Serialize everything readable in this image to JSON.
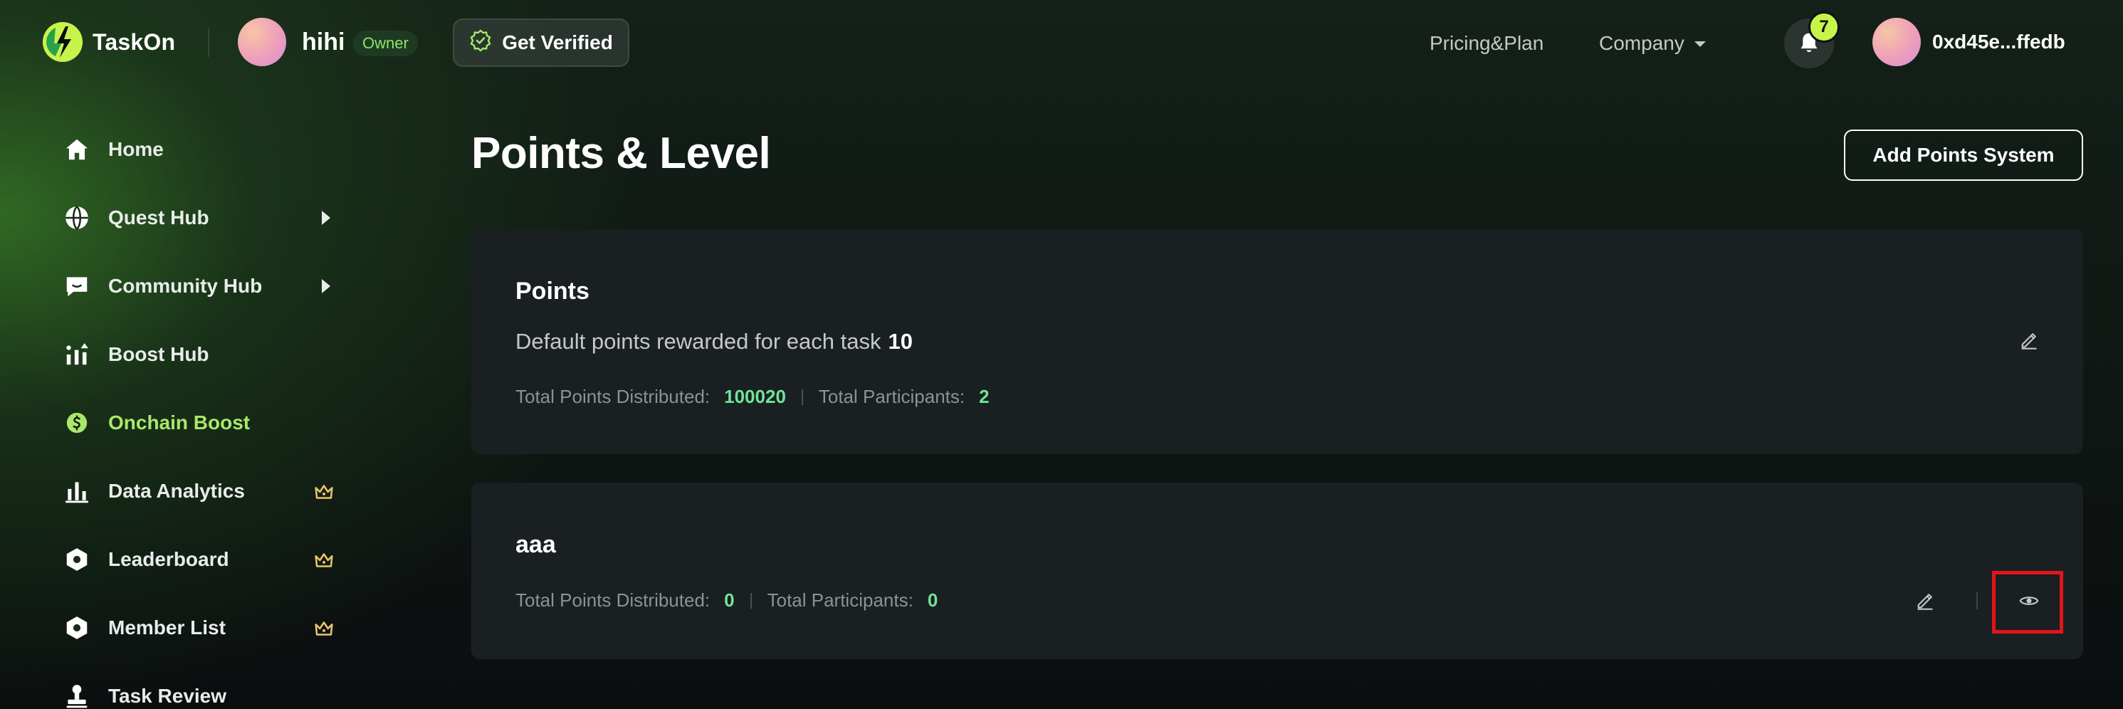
{
  "header": {
    "logo_text": "TaskOn",
    "project_name": "hihi",
    "owner_badge": "Owner",
    "verify_label": "Get Verified",
    "nav": {
      "pricing": "Pricing&Plan",
      "company": "Company"
    },
    "notification_count": "7",
    "user_address": "0xd45e...ffedb"
  },
  "sidebar": {
    "items": [
      {
        "label": "Home",
        "icon": "home-icon"
      },
      {
        "label": "Quest Hub",
        "icon": "globe-icon",
        "has_submenu": true
      },
      {
        "label": "Community Hub",
        "icon": "chat-icon",
        "has_submenu": true
      },
      {
        "label": "Boost Hub",
        "icon": "boost-icon"
      },
      {
        "label": "Onchain Boost",
        "icon": "coin-icon",
        "active": true
      },
      {
        "label": "Data Analytics",
        "icon": "bar-chart-icon",
        "premium": true
      },
      {
        "label": "Leaderboard",
        "icon": "hexagon-icon",
        "premium": true
      },
      {
        "label": "Member List",
        "icon": "hexagon-icon",
        "premium": true
      },
      {
        "label": "Task Review",
        "icon": "stamp-icon"
      }
    ]
  },
  "main": {
    "title": "Points & Level",
    "add_button": "Add Points System",
    "cards": [
      {
        "title": "Points",
        "default_label": "Default points rewarded for each task",
        "default_value": "10",
        "distributed_label": "Total Points Distributed:",
        "distributed_value": "100020",
        "participants_label": "Total Participants:",
        "participants_value": "2"
      },
      {
        "title": "aaa",
        "distributed_label": "Total Points Distributed:",
        "distributed_value": "0",
        "participants_label": "Total Participants:",
        "participants_value": "0"
      }
    ]
  },
  "colors": {
    "accent_green": "#a8e86a",
    "value_green": "#6fe39a",
    "highlight_red": "#e3141b",
    "badge_yellow": "#c7f44a"
  }
}
